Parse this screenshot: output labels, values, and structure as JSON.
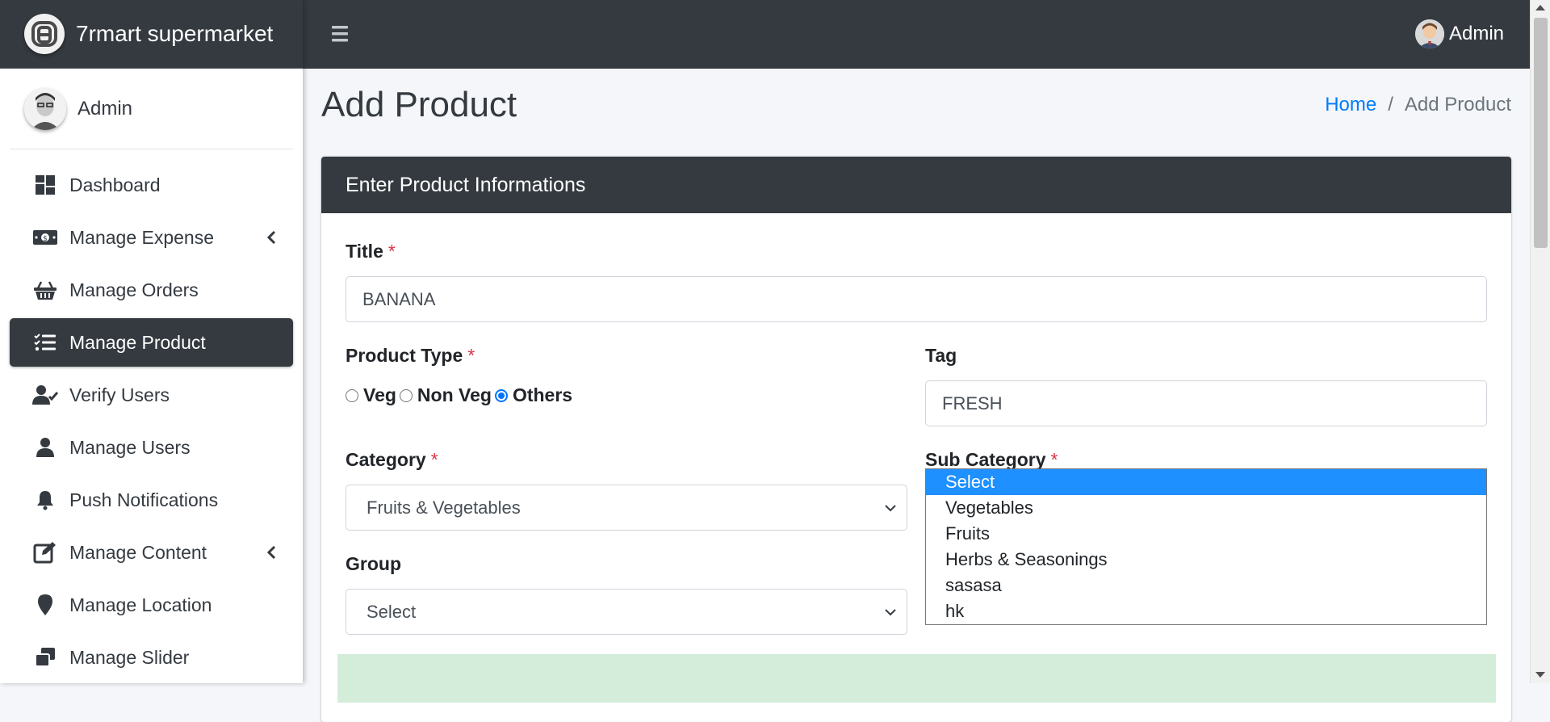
{
  "brand": {
    "name": "7rmart supermarket"
  },
  "user_panel": {
    "name": "Admin"
  },
  "sidebar": {
    "items": [
      {
        "label": "Dashboard",
        "icon": "dashboard-icon"
      },
      {
        "label": "Manage Expense",
        "icon": "money-bill-icon",
        "has_caret": true
      },
      {
        "label": "Manage Orders",
        "icon": "basket-icon"
      },
      {
        "label": "Manage Product",
        "icon": "tasks-icon",
        "active": true
      },
      {
        "label": "Verify Users",
        "icon": "user-check-icon"
      },
      {
        "label": "Manage Users",
        "icon": "user-icon"
      },
      {
        "label": "Push Notifications",
        "icon": "bell-icon"
      },
      {
        "label": "Manage Content",
        "icon": "edit-icon",
        "has_caret": true
      },
      {
        "label": "Manage Location",
        "icon": "map-marker-icon"
      },
      {
        "label": "Manage Slider",
        "icon": "window-restore-icon"
      }
    ]
  },
  "topbar": {
    "user_name": "Admin"
  },
  "page": {
    "title": "Add Product",
    "breadcrumb": {
      "home": "Home",
      "separator": "/",
      "current": "Add Product"
    }
  },
  "card": {
    "header": "Enter Product Informations"
  },
  "form": {
    "title": {
      "label": "Title",
      "required": "*",
      "value": "BANANA"
    },
    "product_type": {
      "label": "Product Type",
      "required": "*",
      "options": [
        "Veg",
        "Non Veg",
        "Others"
      ],
      "selected": "Others"
    },
    "tag": {
      "label": "Tag",
      "value": "FRESH"
    },
    "category": {
      "label": "Category",
      "required": "*",
      "value": "Fruits & Vegetables"
    },
    "sub_category": {
      "label": "Sub Category",
      "required": "*",
      "options": [
        "Select",
        "Vegetables",
        "Fruits",
        "Herbs & Seasonings",
        "sasasa",
        "hk"
      ],
      "highlighted": "Select"
    },
    "group": {
      "label": "Group",
      "value": "Select"
    }
  },
  "colors": {
    "dark": "#343a40",
    "link": "#007bff",
    "required": "#dc3545",
    "highlight": "#1e90ff",
    "success_bg": "#d4edda"
  }
}
